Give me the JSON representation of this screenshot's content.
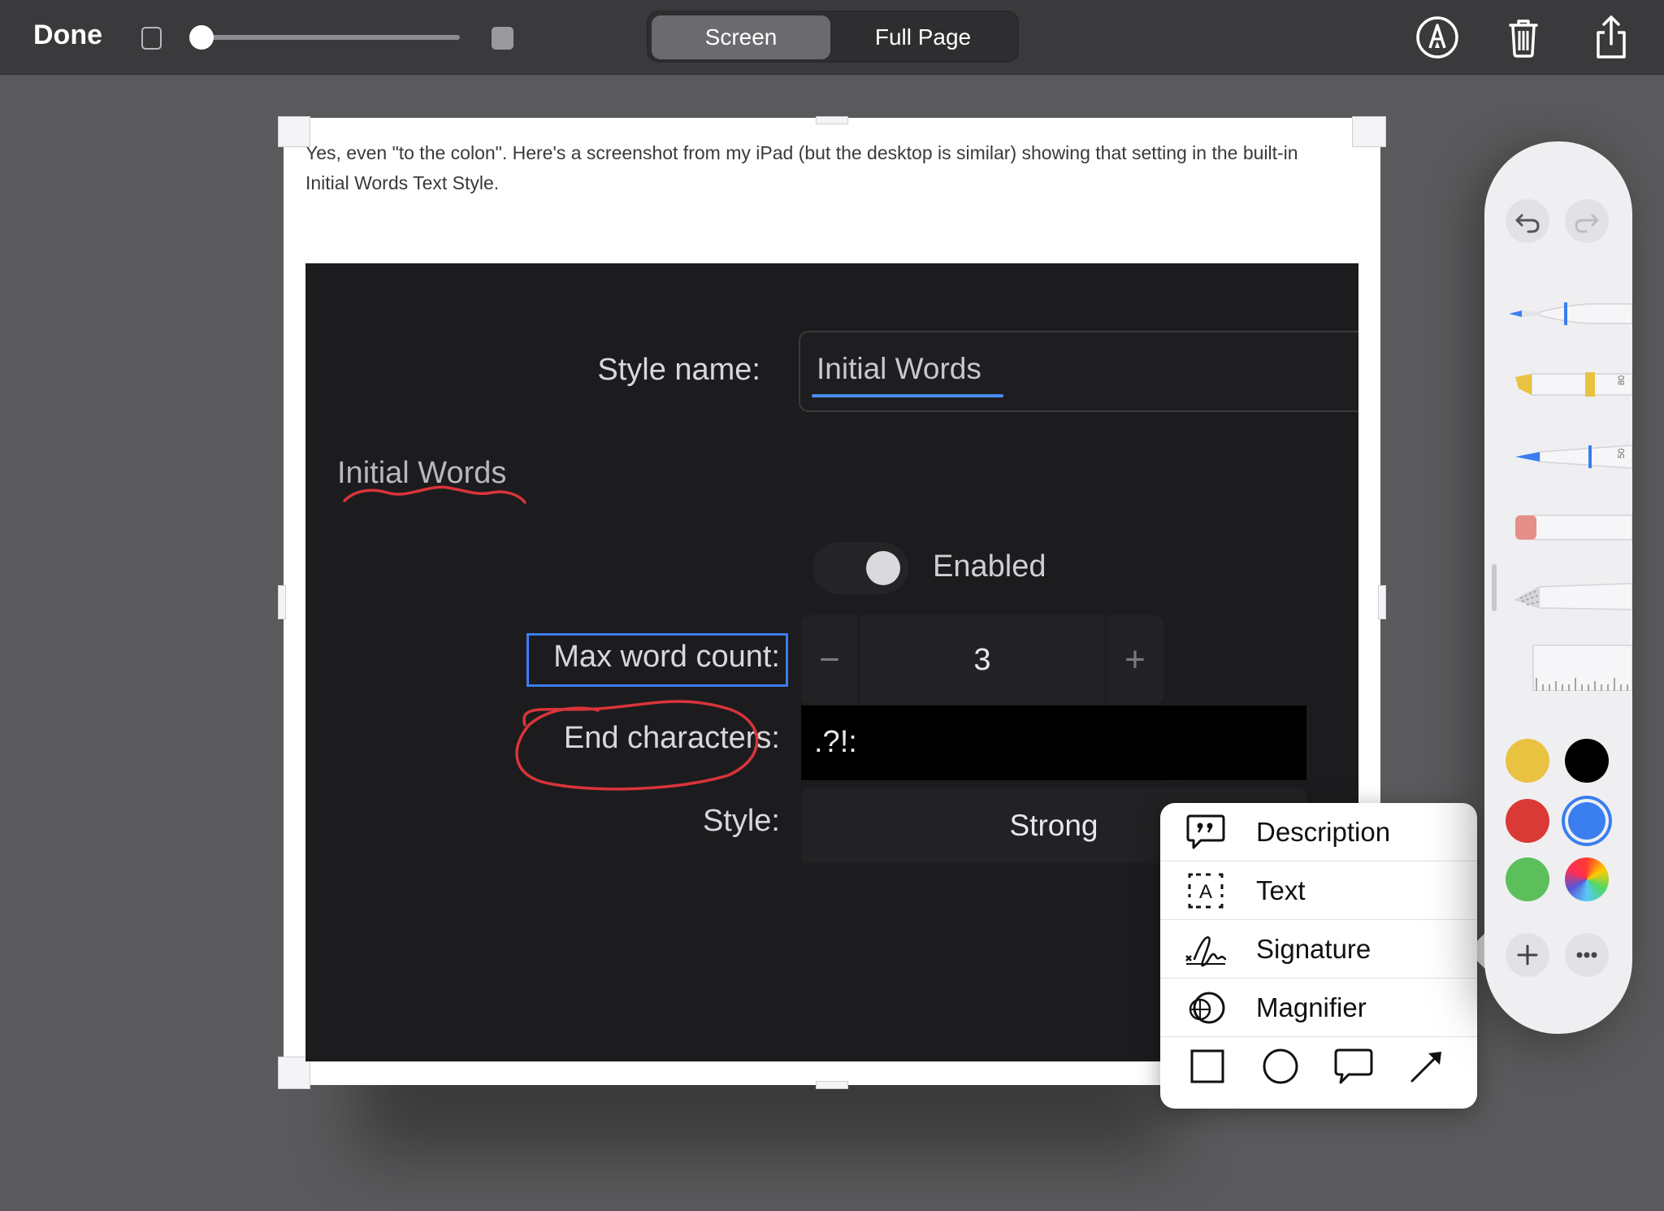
{
  "toolbar": {
    "done_label": "Done",
    "segments": {
      "screen": "Screen",
      "full_page": "Full Page"
    },
    "selected_segment": "Screen",
    "opacity_slider_fraction": 0.0,
    "icons": [
      "markup-pen-icon",
      "trash-icon",
      "share-icon"
    ]
  },
  "page": {
    "text": "Yes, even \"to the colon\". Here's a screenshot from my iPad (but the desktop is similar) showing that setting in the built-in Initial Words Text Style."
  },
  "inner": {
    "style_name_label": "Style name:",
    "style_name_value": "Initial Words",
    "section_title": "Initial Words",
    "toggle_label": "Enabled",
    "toggle_on": false,
    "max_word_label": "Max word count:",
    "max_word_value": "3",
    "stepper_minus": "−",
    "stepper_plus": "+",
    "end_chars_label": "End characters:",
    "end_chars_value": ".?!:",
    "style_label": "Style:",
    "style_value": "Strong"
  },
  "popup_menu": {
    "items": [
      {
        "label": "Description",
        "icon": "quote-bubble-icon"
      },
      {
        "label": "Text",
        "icon": "text-box-icon"
      },
      {
        "label": "Signature",
        "icon": "signature-icon"
      },
      {
        "label": "Magnifier",
        "icon": "magnifier-icon"
      }
    ],
    "shapes": [
      "square-shape-icon",
      "circle-shape-icon",
      "speech-bubble-shape-icon",
      "arrow-shape-icon"
    ]
  },
  "palette": {
    "tools": [
      "pen",
      "highlighter",
      "pencil",
      "eraser",
      "lasso",
      "ruler"
    ],
    "tool_numbers": {
      "highlighter": "80",
      "pencil": "50"
    },
    "colors": [
      "#e8c240",
      "#000000",
      "#d93a36",
      "#3a7ef0",
      "#5cbf5c",
      "spectrum"
    ],
    "selected_color": "#3a7ef0",
    "accent": "#3d7cf2"
  }
}
